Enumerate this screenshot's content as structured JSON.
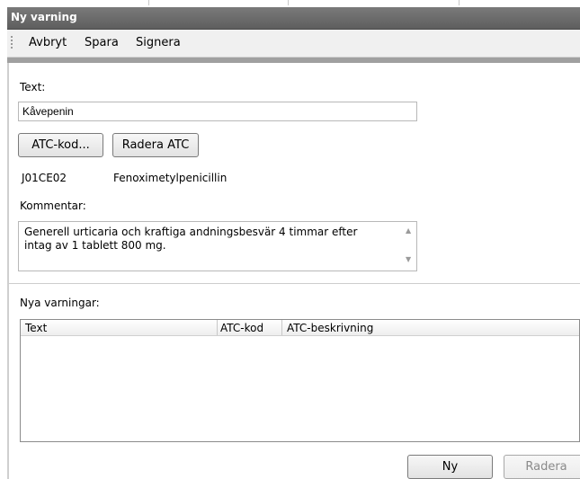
{
  "window": {
    "title": "Ny varning"
  },
  "toolbar": {
    "items": [
      "Avbryt",
      "Spara",
      "Signera"
    ]
  },
  "form": {
    "text_label": "Text:",
    "text_value": "Kåvepenin",
    "atc_button": "ATC-kod...",
    "delete_atc_button": "Radera ATC",
    "atc_code": "J01CE02",
    "atc_description": "Fenoximetylpenicillin",
    "comment_label": "Kommentar:",
    "comment_value": "Generell urticaria och kraftiga andningsbesvär 4 timmar efter\nintag av 1 tablett 800 mg."
  },
  "warnings": {
    "label": "Nya varningar:",
    "columns": [
      "Text",
      "ATC-kod",
      "ATC-beskrivning"
    ],
    "rows": []
  },
  "actions": {
    "new": "Ny",
    "delete": "Radera"
  }
}
